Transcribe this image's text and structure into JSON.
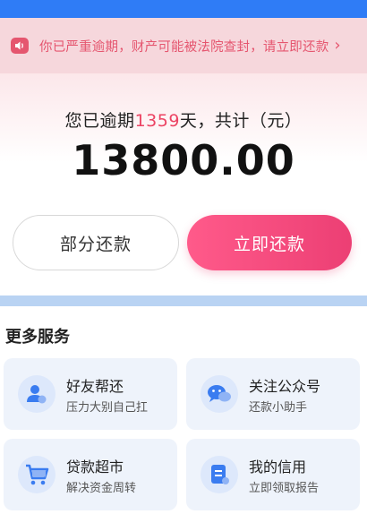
{
  "notice": {
    "text": "你已严重逾期，财产可能被法院查封，请立即还款",
    "chevron": "›",
    "icon": "speaker-icon"
  },
  "overdue": {
    "prefix": "您已逾期",
    "days": "1359",
    "suffix": "天，共计（元）"
  },
  "amount": "13800.00",
  "buttons": {
    "partial": "部分还款",
    "repay": "立即还款"
  },
  "services": {
    "title": "更多服务",
    "items": [
      {
        "title": "好友帮还",
        "subtitle": "压力大别自己扛",
        "icon": "user-icon"
      },
      {
        "title": "关注公众号",
        "subtitle": "还款小助手",
        "icon": "wechat-icon"
      },
      {
        "title": "贷款超市",
        "subtitle": "解决资金周转",
        "icon": "cart-icon"
      },
      {
        "title": "我的信用",
        "subtitle": "立即领取报告",
        "icon": "credit-report-icon"
      }
    ]
  },
  "colors": {
    "accent": "#ec4363",
    "button_gradient_start": "#ff5a8a",
    "button_gradient_end": "#ec3f74",
    "notice_bg": "#f6d7dc",
    "icon_blue": "#3a7cf0"
  }
}
